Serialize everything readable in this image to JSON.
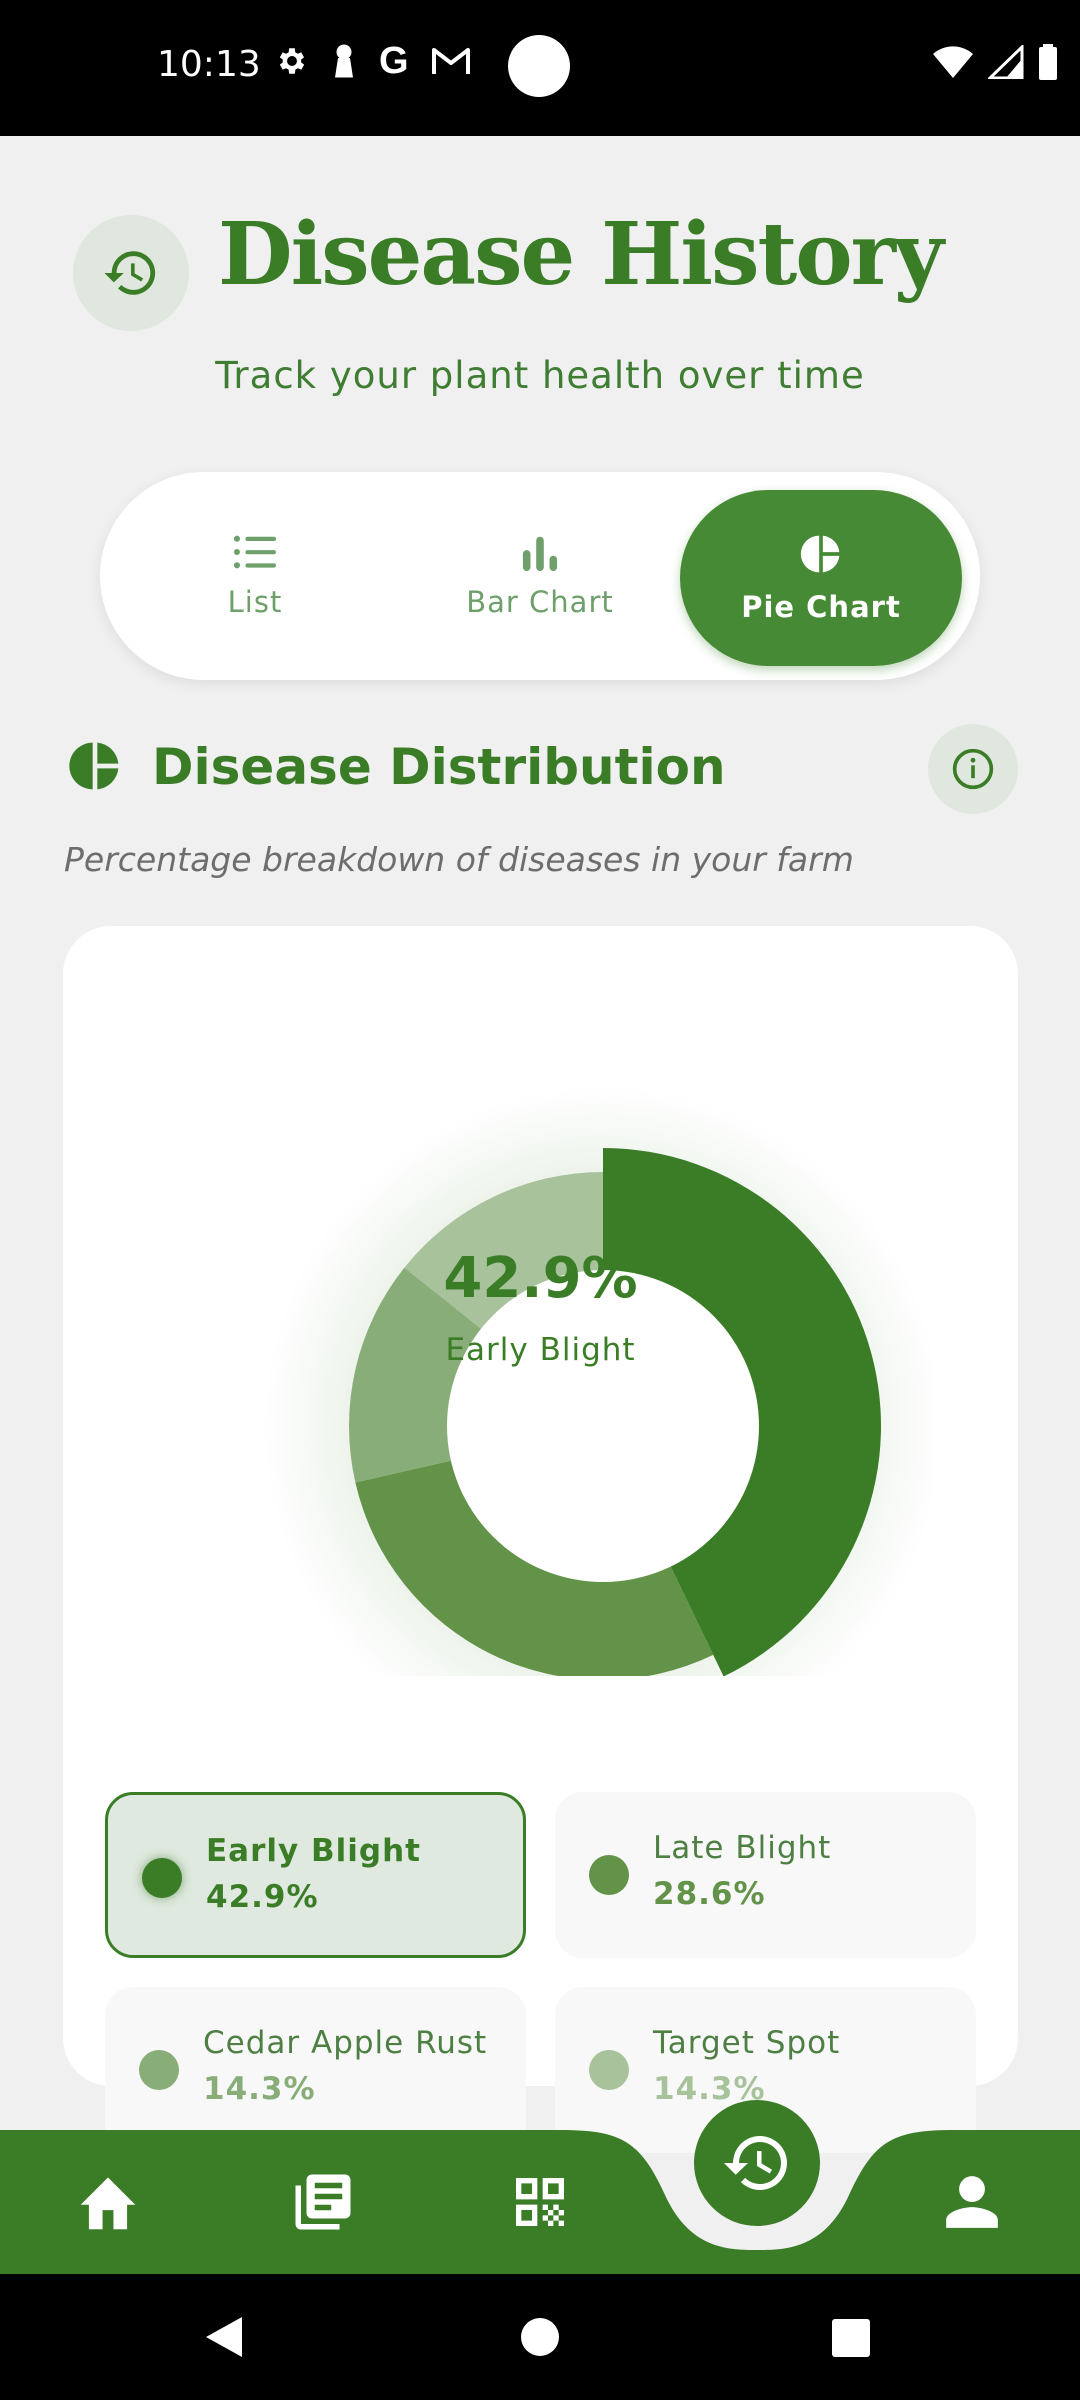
{
  "status_bar": {
    "time": "10:13"
  },
  "header": {
    "title": "Disease History",
    "subtitle": "Track your plant health over time",
    "history_icon": "history-icon"
  },
  "tabs": [
    {
      "label": "List",
      "icon": "list-icon",
      "active": false
    },
    {
      "label": "Bar Chart",
      "icon": "bar-chart-icon",
      "active": false
    },
    {
      "label": "Pie Chart",
      "icon": "pie-chart-icon",
      "active": true
    }
  ],
  "section": {
    "title": "Disease Distribution",
    "description": "Percentage breakdown of diseases in your farm"
  },
  "chart_data": {
    "type": "pie",
    "categories": [
      "Early Blight",
      "Late Blight",
      "Cedar Apple Rust",
      "Target Spot"
    ],
    "values": [
      42.9,
      28.6,
      14.3,
      14.3
    ],
    "value_labels": [
      "42.9%",
      "28.6%",
      "14.3%",
      "14.3%"
    ],
    "colors": [
      "#3b7d27",
      "#629349",
      "#88ad79",
      "#a8c39c"
    ],
    "selected_index": 0,
    "center_value": "42.9%",
    "center_label": "Early Blight"
  },
  "legend": [
    {
      "name": "Early Blight",
      "pct": "42.9%",
      "color": "#3b7d27",
      "text_color": "#3b7d27"
    },
    {
      "name": "Late Blight",
      "pct": "28.6%",
      "color": "#629349",
      "text_color": "#629349"
    },
    {
      "name": "Cedar Apple Rust",
      "pct": "14.3%",
      "color": "#88ad79",
      "text_color": "#88ad79"
    },
    {
      "name": "Target Spot",
      "pct": "14.3%",
      "color": "#a8c39c",
      "text_color": "#a8c39c"
    }
  ],
  "bottom_nav": {
    "items": [
      "home-icon",
      "news-icon",
      "qr-scan-icon",
      "history-icon",
      "profile-icon"
    ],
    "active": "history-icon"
  },
  "colors": {
    "primary": "#3b7d27",
    "active_tab": "#468a35",
    "background": "#f0f0f0"
  }
}
